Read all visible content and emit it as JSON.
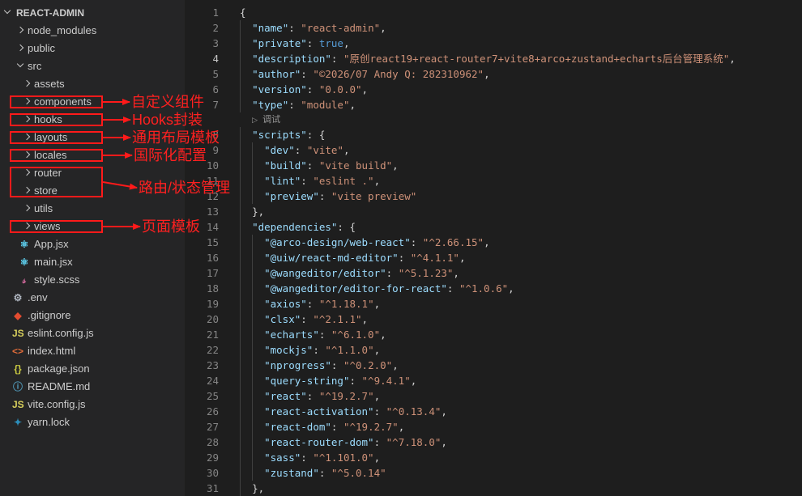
{
  "explorer": {
    "root": "REACT-ADMIN",
    "items": [
      {
        "label": "node_modules",
        "type": "folder",
        "depth": 1
      },
      {
        "label": "public",
        "type": "folder",
        "depth": 1
      },
      {
        "label": "src",
        "type": "folder-open",
        "depth": 1
      },
      {
        "label": "assets",
        "type": "folder",
        "depth": 2
      },
      {
        "label": "components",
        "type": "folder",
        "depth": 2
      },
      {
        "label": "hooks",
        "type": "folder",
        "depth": 2
      },
      {
        "label": "layouts",
        "type": "folder",
        "depth": 2
      },
      {
        "label": "locales",
        "type": "folder",
        "depth": 2
      },
      {
        "label": "router",
        "type": "folder",
        "depth": 2
      },
      {
        "label": "store",
        "type": "folder",
        "depth": 2
      },
      {
        "label": "utils",
        "type": "folder",
        "depth": 2
      },
      {
        "label": "views",
        "type": "folder",
        "depth": 2
      },
      {
        "label": "App.jsx",
        "type": "file",
        "icon": "react-icon",
        "depth": 2
      },
      {
        "label": "main.jsx",
        "type": "file",
        "icon": "react-icon",
        "depth": 2
      },
      {
        "label": "style.scss",
        "type": "file",
        "icon": "sass-icon",
        "depth": 2
      },
      {
        "label": ".env",
        "type": "file",
        "icon": "gear-icon",
        "depth": 1
      },
      {
        "label": ".gitignore",
        "type": "file",
        "icon": "git-icon",
        "depth": 1
      },
      {
        "label": "eslint.config.js",
        "type": "file",
        "icon": "js-icon",
        "depth": 1
      },
      {
        "label": "index.html",
        "type": "file",
        "icon": "html-icon",
        "depth": 1
      },
      {
        "label": "package.json",
        "type": "file",
        "icon": "json-icon",
        "depth": 1
      },
      {
        "label": "README.md",
        "type": "file",
        "icon": "info-icon",
        "depth": 1
      },
      {
        "label": "vite.config.js",
        "type": "file",
        "icon": "js-icon",
        "depth": 1
      },
      {
        "label": "yarn.lock",
        "type": "file",
        "icon": "yarn-icon",
        "depth": 1
      }
    ]
  },
  "editor": {
    "active_line": 4,
    "codelens": "调试",
    "lines": [
      {
        "n": 1,
        "indent": 0,
        "tokens": [
          [
            "p",
            "{"
          ]
        ]
      },
      {
        "n": 2,
        "indent": 1,
        "tokens": [
          [
            "k",
            "\"name\""
          ],
          [
            "p",
            ": "
          ],
          [
            "s",
            "\"react-admin\""
          ],
          [
            "p",
            ","
          ]
        ]
      },
      {
        "n": 3,
        "indent": 1,
        "tokens": [
          [
            "k",
            "\"private\""
          ],
          [
            "p",
            ": "
          ],
          [
            "b",
            "true"
          ],
          [
            "p",
            ","
          ]
        ]
      },
      {
        "n": 4,
        "indent": 1,
        "tokens": [
          [
            "k",
            "\"description\""
          ],
          [
            "p",
            ": "
          ],
          [
            "s",
            "\"原创react19+react-router7+vite8+arco+zustand+echarts后台管理系统\""
          ],
          [
            "p",
            ","
          ]
        ]
      },
      {
        "n": 5,
        "indent": 1,
        "tokens": [
          [
            "k",
            "\"author\""
          ],
          [
            "p",
            ": "
          ],
          [
            "s",
            "\"©2026/07 Andy Q: 282310962\""
          ],
          [
            "p",
            ","
          ]
        ]
      },
      {
        "n": 6,
        "indent": 1,
        "tokens": [
          [
            "k",
            "\"version\""
          ],
          [
            "p",
            ": "
          ],
          [
            "s",
            "\"0.0.0\""
          ],
          [
            "p",
            ","
          ]
        ]
      },
      {
        "n": 7,
        "indent": 1,
        "tokens": [
          [
            "k",
            "\"type\""
          ],
          [
            "p",
            ": "
          ],
          [
            "s",
            "\"module\""
          ],
          [
            "p",
            ","
          ]
        ]
      },
      {
        "n": 8,
        "indent": 1,
        "tokens": [
          [
            "k",
            "\"scripts\""
          ],
          [
            "p",
            ": {"
          ]
        ]
      },
      {
        "n": 9,
        "indent": 2,
        "tokens": [
          [
            "k",
            "\"dev\""
          ],
          [
            "p",
            ": "
          ],
          [
            "s",
            "\"vite\""
          ],
          [
            "p",
            ","
          ]
        ]
      },
      {
        "n": 10,
        "indent": 2,
        "tokens": [
          [
            "k",
            "\"build\""
          ],
          [
            "p",
            ": "
          ],
          [
            "s",
            "\"vite build\""
          ],
          [
            "p",
            ","
          ]
        ]
      },
      {
        "n": 11,
        "indent": 2,
        "tokens": [
          [
            "k",
            "\"lint\""
          ],
          [
            "p",
            ": "
          ],
          [
            "s",
            "\"eslint .\""
          ],
          [
            "p",
            ","
          ]
        ]
      },
      {
        "n": 12,
        "indent": 2,
        "tokens": [
          [
            "k",
            "\"preview\""
          ],
          [
            "p",
            ": "
          ],
          [
            "s",
            "\"vite preview\""
          ]
        ]
      },
      {
        "n": 13,
        "indent": 1,
        "tokens": [
          [
            "p",
            "},"
          ]
        ]
      },
      {
        "n": 14,
        "indent": 1,
        "tokens": [
          [
            "k",
            "\"dependencies\""
          ],
          [
            "p",
            ": {"
          ]
        ]
      },
      {
        "n": 15,
        "indent": 2,
        "tokens": [
          [
            "k",
            "\"@arco-design/web-react\""
          ],
          [
            "p",
            ": "
          ],
          [
            "s",
            "\"^2.66.15\""
          ],
          [
            "p",
            ","
          ]
        ]
      },
      {
        "n": 16,
        "indent": 2,
        "tokens": [
          [
            "k",
            "\"@uiw/react-md-editor\""
          ],
          [
            "p",
            ": "
          ],
          [
            "s",
            "\"^4.1.1\""
          ],
          [
            "p",
            ","
          ]
        ]
      },
      {
        "n": 17,
        "indent": 2,
        "tokens": [
          [
            "k",
            "\"@wangeditor/editor\""
          ],
          [
            "p",
            ": "
          ],
          [
            "s",
            "\"^5.1.23\""
          ],
          [
            "p",
            ","
          ]
        ]
      },
      {
        "n": 18,
        "indent": 2,
        "tokens": [
          [
            "k",
            "\"@wangeditor/editor-for-react\""
          ],
          [
            "p",
            ": "
          ],
          [
            "s",
            "\"^1.0.6\""
          ],
          [
            "p",
            ","
          ]
        ]
      },
      {
        "n": 19,
        "indent": 2,
        "tokens": [
          [
            "k",
            "\"axios\""
          ],
          [
            "p",
            ": "
          ],
          [
            "s",
            "\"^1.18.1\""
          ],
          [
            "p",
            ","
          ]
        ]
      },
      {
        "n": 20,
        "indent": 2,
        "tokens": [
          [
            "k",
            "\"clsx\""
          ],
          [
            "p",
            ": "
          ],
          [
            "s",
            "\"^2.1.1\""
          ],
          [
            "p",
            ","
          ]
        ]
      },
      {
        "n": 21,
        "indent": 2,
        "tokens": [
          [
            "k",
            "\"echarts\""
          ],
          [
            "p",
            ": "
          ],
          [
            "s",
            "\"^6.1.0\""
          ],
          [
            "p",
            ","
          ]
        ]
      },
      {
        "n": 22,
        "indent": 2,
        "tokens": [
          [
            "k",
            "\"mockjs\""
          ],
          [
            "p",
            ": "
          ],
          [
            "s",
            "\"^1.1.0\""
          ],
          [
            "p",
            ","
          ]
        ]
      },
      {
        "n": 23,
        "indent": 2,
        "tokens": [
          [
            "k",
            "\"nprogress\""
          ],
          [
            "p",
            ": "
          ],
          [
            "s",
            "\"^0.2.0\""
          ],
          [
            "p",
            ","
          ]
        ]
      },
      {
        "n": 24,
        "indent": 2,
        "tokens": [
          [
            "k",
            "\"query-string\""
          ],
          [
            "p",
            ": "
          ],
          [
            "s",
            "\"^9.4.1\""
          ],
          [
            "p",
            ","
          ]
        ]
      },
      {
        "n": 25,
        "indent": 2,
        "tokens": [
          [
            "k",
            "\"react\""
          ],
          [
            "p",
            ": "
          ],
          [
            "s",
            "\"^19.2.7\""
          ],
          [
            "p",
            ","
          ]
        ]
      },
      {
        "n": 26,
        "indent": 2,
        "tokens": [
          [
            "k",
            "\"react-activation\""
          ],
          [
            "p",
            ": "
          ],
          [
            "s",
            "\"^0.13.4\""
          ],
          [
            "p",
            ","
          ]
        ]
      },
      {
        "n": 27,
        "indent": 2,
        "tokens": [
          [
            "k",
            "\"react-dom\""
          ],
          [
            "p",
            ": "
          ],
          [
            "s",
            "\"^19.2.7\""
          ],
          [
            "p",
            ","
          ]
        ]
      },
      {
        "n": 28,
        "indent": 2,
        "tokens": [
          [
            "k",
            "\"react-router-dom\""
          ],
          [
            "p",
            ": "
          ],
          [
            "s",
            "\"^7.18.0\""
          ],
          [
            "p",
            ","
          ]
        ]
      },
      {
        "n": 29,
        "indent": 2,
        "tokens": [
          [
            "k",
            "\"sass\""
          ],
          [
            "p",
            ": "
          ],
          [
            "s",
            "\"^1.101.0\""
          ],
          [
            "p",
            ","
          ]
        ]
      },
      {
        "n": 30,
        "indent": 2,
        "tokens": [
          [
            "k",
            "\"zustand\""
          ],
          [
            "p",
            ": "
          ],
          [
            "s",
            "\"^5.0.14\""
          ]
        ]
      },
      {
        "n": 31,
        "indent": 1,
        "tokens": [
          [
            "p",
            "},"
          ]
        ]
      }
    ]
  },
  "annotations": [
    {
      "label": "自定义组件",
      "targets": [
        4
      ]
    },
    {
      "label": "Hooks封装",
      "targets": [
        5
      ]
    },
    {
      "label": "通用布局模板",
      "targets": [
        6
      ]
    },
    {
      "label": "国际化配置",
      "targets": [
        7
      ]
    },
    {
      "label": "路由/状态管理",
      "targets": [
        8,
        9
      ]
    },
    {
      "label": "页面模板",
      "targets": [
        11
      ]
    }
  ],
  "colors": {
    "sidebar_bg": "#252526",
    "editor_bg": "#1e1e1e",
    "annotation_red": "#ff1a1a",
    "json_key": "#9cdcfe",
    "json_string": "#ce9178",
    "json_bool": "#569cd6",
    "line_number": "#858585"
  }
}
